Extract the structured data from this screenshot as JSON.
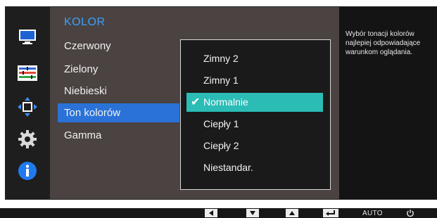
{
  "menu": {
    "title": "KOLOR",
    "items": [
      {
        "label": "Czerwony",
        "selected": false
      },
      {
        "label": "Zielony",
        "selected": false
      },
      {
        "label": "Niebieski",
        "selected": false
      },
      {
        "label": "Ton kolorów",
        "selected": true
      },
      {
        "label": "Gamma",
        "selected": false
      }
    ]
  },
  "submenu": {
    "options": [
      {
        "label": "Zimny 2",
        "selected": false
      },
      {
        "label": "Zimny 1",
        "selected": false
      },
      {
        "label": "Normalnie",
        "selected": true
      },
      {
        "label": "Ciepły 1",
        "selected": false
      },
      {
        "label": "Ciepły 2",
        "selected": false
      },
      {
        "label": "Niestandar.",
        "selected": false
      }
    ],
    "check_icon": "checkmark-icon"
  },
  "description": {
    "text": "Wybór tonacji kolorów\nnajlepiej odpowiadające\nwarunkom oglądania."
  },
  "sidebar_icons": [
    "monitor-icon",
    "color-bars-icon",
    "move-arrows-icon",
    "gear-icon",
    "info-icon"
  ],
  "bottom_bar": {
    "buttons": [
      "left-arrow-icon",
      "down-arrow-icon",
      "up-arrow-icon",
      "enter-icon",
      "AUTO",
      "power-icon"
    ],
    "auto_label": "AUTO"
  },
  "colors": {
    "menu_title": "#3aa0ff",
    "menu_selected": "#2a72d8",
    "submenu_selected": "#2bbcb6",
    "panel_bg": "#4a4341"
  }
}
